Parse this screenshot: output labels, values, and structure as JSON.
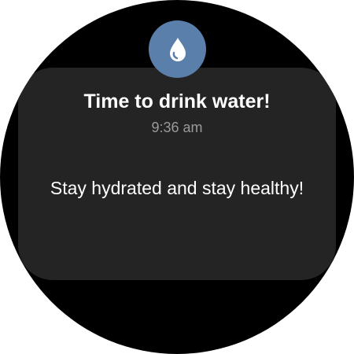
{
  "notification": {
    "app_icon": "water-drop-icon",
    "title": "Time to drink water!",
    "time": "9:36 am",
    "message": "Stay hydrated and stay healthy!"
  },
  "colors": {
    "background": "#000000",
    "card": "#242424",
    "icon_badge": "#5a7fab",
    "title_text": "#ffffff",
    "time_text": "#9a9a9a"
  }
}
